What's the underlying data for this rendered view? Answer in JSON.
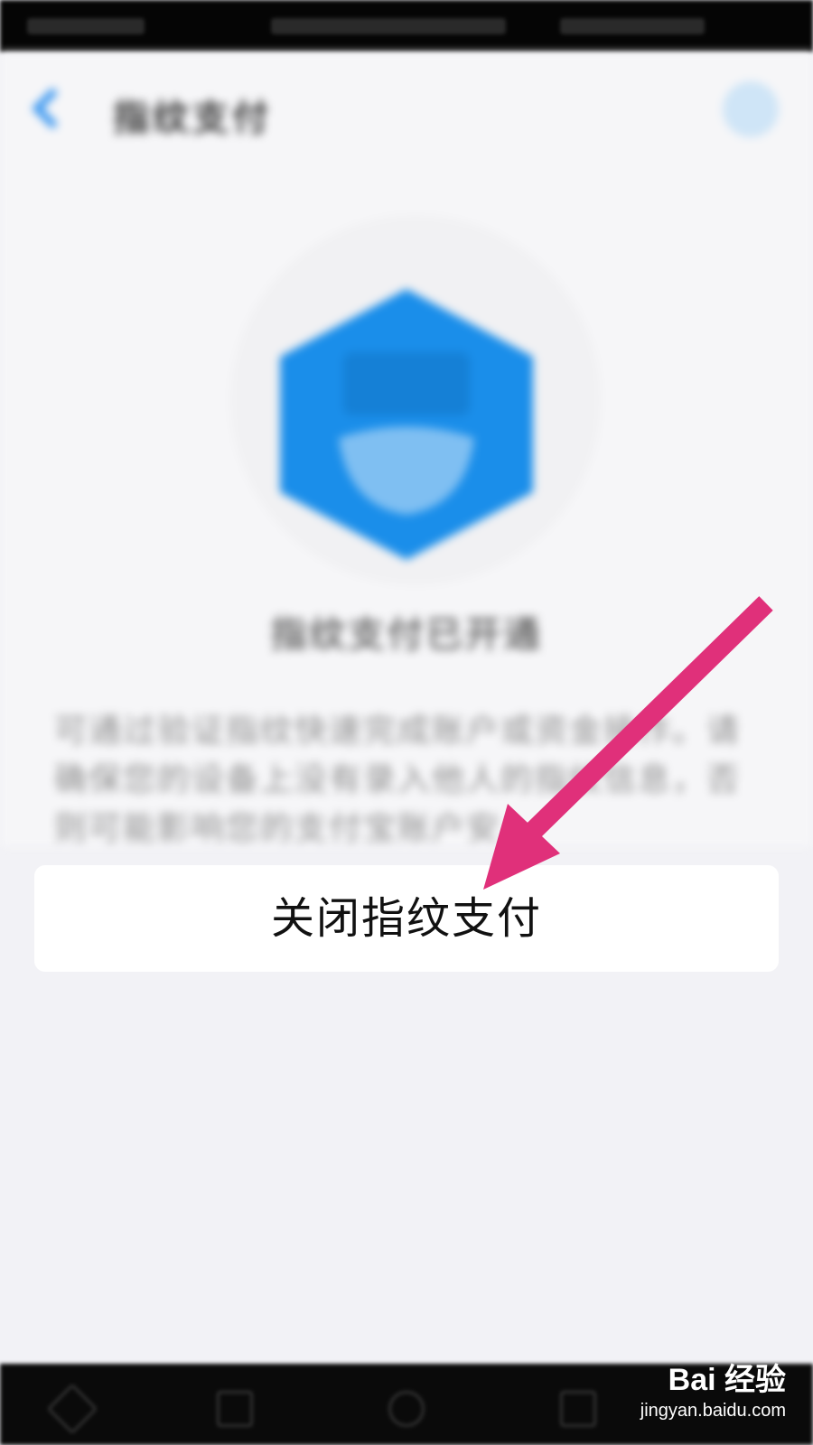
{
  "header": {
    "title": "指纹支付"
  },
  "hero": {
    "title": "指纹支付已开通",
    "description": "可通过验证指纹快速完成账户或资金操作。请确保您的设备上没有录入他人的指纹信息，否则可能影响您的支付宝账户安"
  },
  "actions": {
    "close_fingerprint_label": "关闭指纹支付"
  },
  "watermark": {
    "brand": "Bai 经验",
    "site": "jingyan.baidu.com"
  },
  "colors": {
    "accent": "#1a8eea",
    "arrow": "#e0307a",
    "background": "#f2f2f6"
  }
}
